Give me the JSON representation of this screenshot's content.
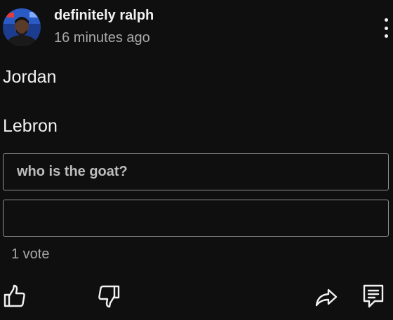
{
  "post": {
    "author": "definitely ralph",
    "timestamp": "16 minutes ago",
    "body_lines": [
      "Jordan",
      "Lebron"
    ]
  },
  "poll": {
    "options": [
      "who is the goat?",
      ""
    ],
    "vote_count": "1 vote"
  },
  "icons": {
    "menu": "more-vert-icon",
    "like": "thumb-up-icon",
    "dislike": "thumb-down-icon",
    "share": "share-icon",
    "comment": "comment-icon"
  },
  "colors": {
    "background": "#0f0f0f",
    "text": "#f1f1f1",
    "secondary_text": "#aaaaaa",
    "option_border": "#8f8f8f"
  }
}
